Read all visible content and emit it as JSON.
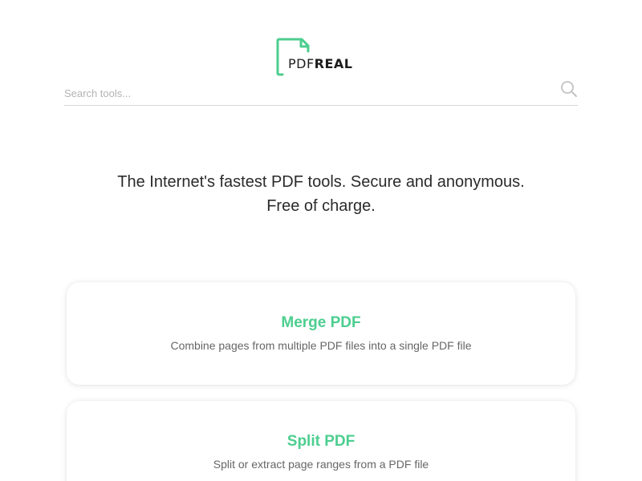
{
  "brand": {
    "logo_light": "PDF",
    "logo_bold": "REAL",
    "accent_color": "#4cce8f"
  },
  "search": {
    "placeholder": "Search tools...",
    "icon": "search-icon"
  },
  "hero": {
    "line1": "The Internet's fastest PDF tools. Secure and anonymous.",
    "line2": "Free of charge."
  },
  "tools": [
    {
      "title": "Merge PDF",
      "description": "Combine pages from multiple PDF files into a single PDF file"
    },
    {
      "title": "Split PDF",
      "description": "Split or extract page ranges from a PDF file"
    }
  ]
}
